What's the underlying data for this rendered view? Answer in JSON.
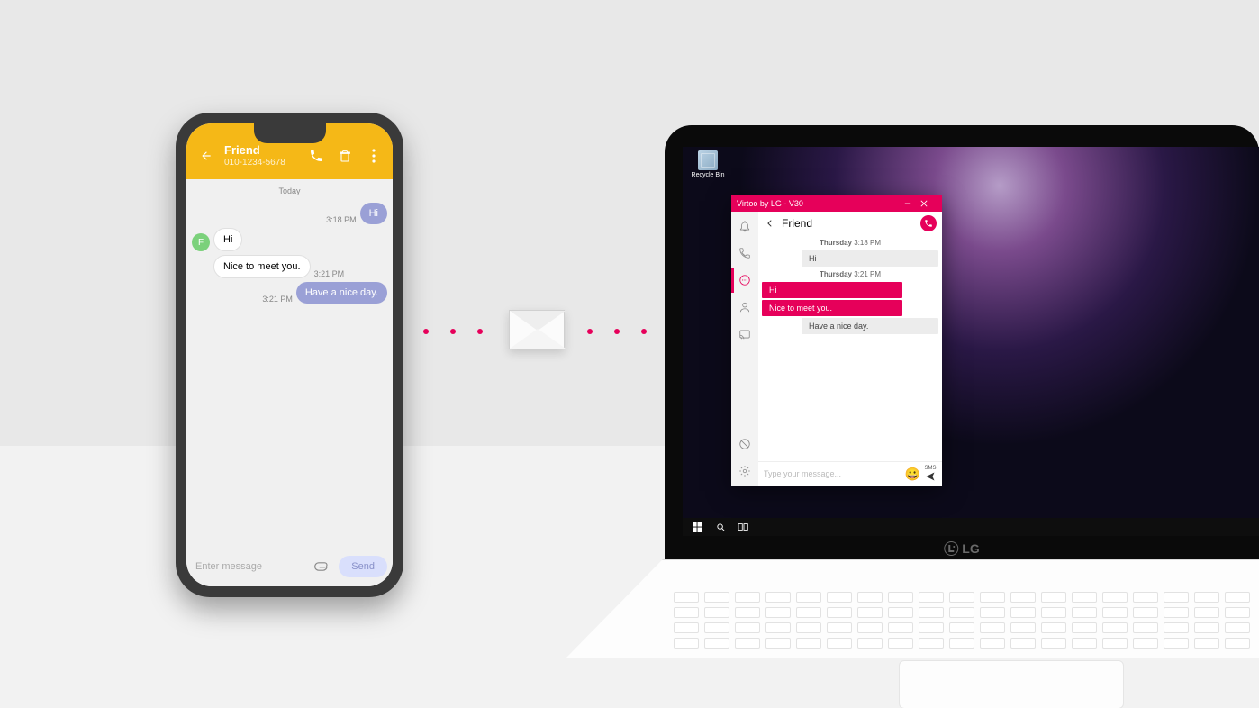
{
  "phone": {
    "contact_name": "Friend",
    "contact_number": "010-1234-5678",
    "date_label": "Today",
    "avatar_initial": "F",
    "input_placeholder": "Enter message",
    "send_label": "Send",
    "messages": [
      {
        "dir": "out",
        "time": "3:18 PM",
        "text": "Hi"
      },
      {
        "dir": "in",
        "time": "",
        "text": "Hi"
      },
      {
        "dir": "in",
        "time": "3:21 PM",
        "text": "Nice to meet you."
      },
      {
        "dir": "out",
        "time": "3:21 PM",
        "text": "Have a nice day."
      }
    ]
  },
  "desktop": {
    "recycle_bin": "Recycle Bin",
    "brand": "LG"
  },
  "app": {
    "title": "Virtoo by LG - V30",
    "contact_name": "Friend",
    "input_placeholder": "Type your message...",
    "send_label": "SMS",
    "stamps": [
      {
        "day": "Thursday",
        "time": "3:18 PM"
      },
      {
        "day": "Thursday",
        "time": "3:21 PM"
      }
    ],
    "messages": [
      {
        "dir": "recv",
        "text": "Hi"
      },
      {
        "dir": "sent",
        "text": "Hi"
      },
      {
        "dir": "sent",
        "text": "Nice to meet you."
      },
      {
        "dir": "recv",
        "text": "Have a nice day."
      }
    ]
  }
}
